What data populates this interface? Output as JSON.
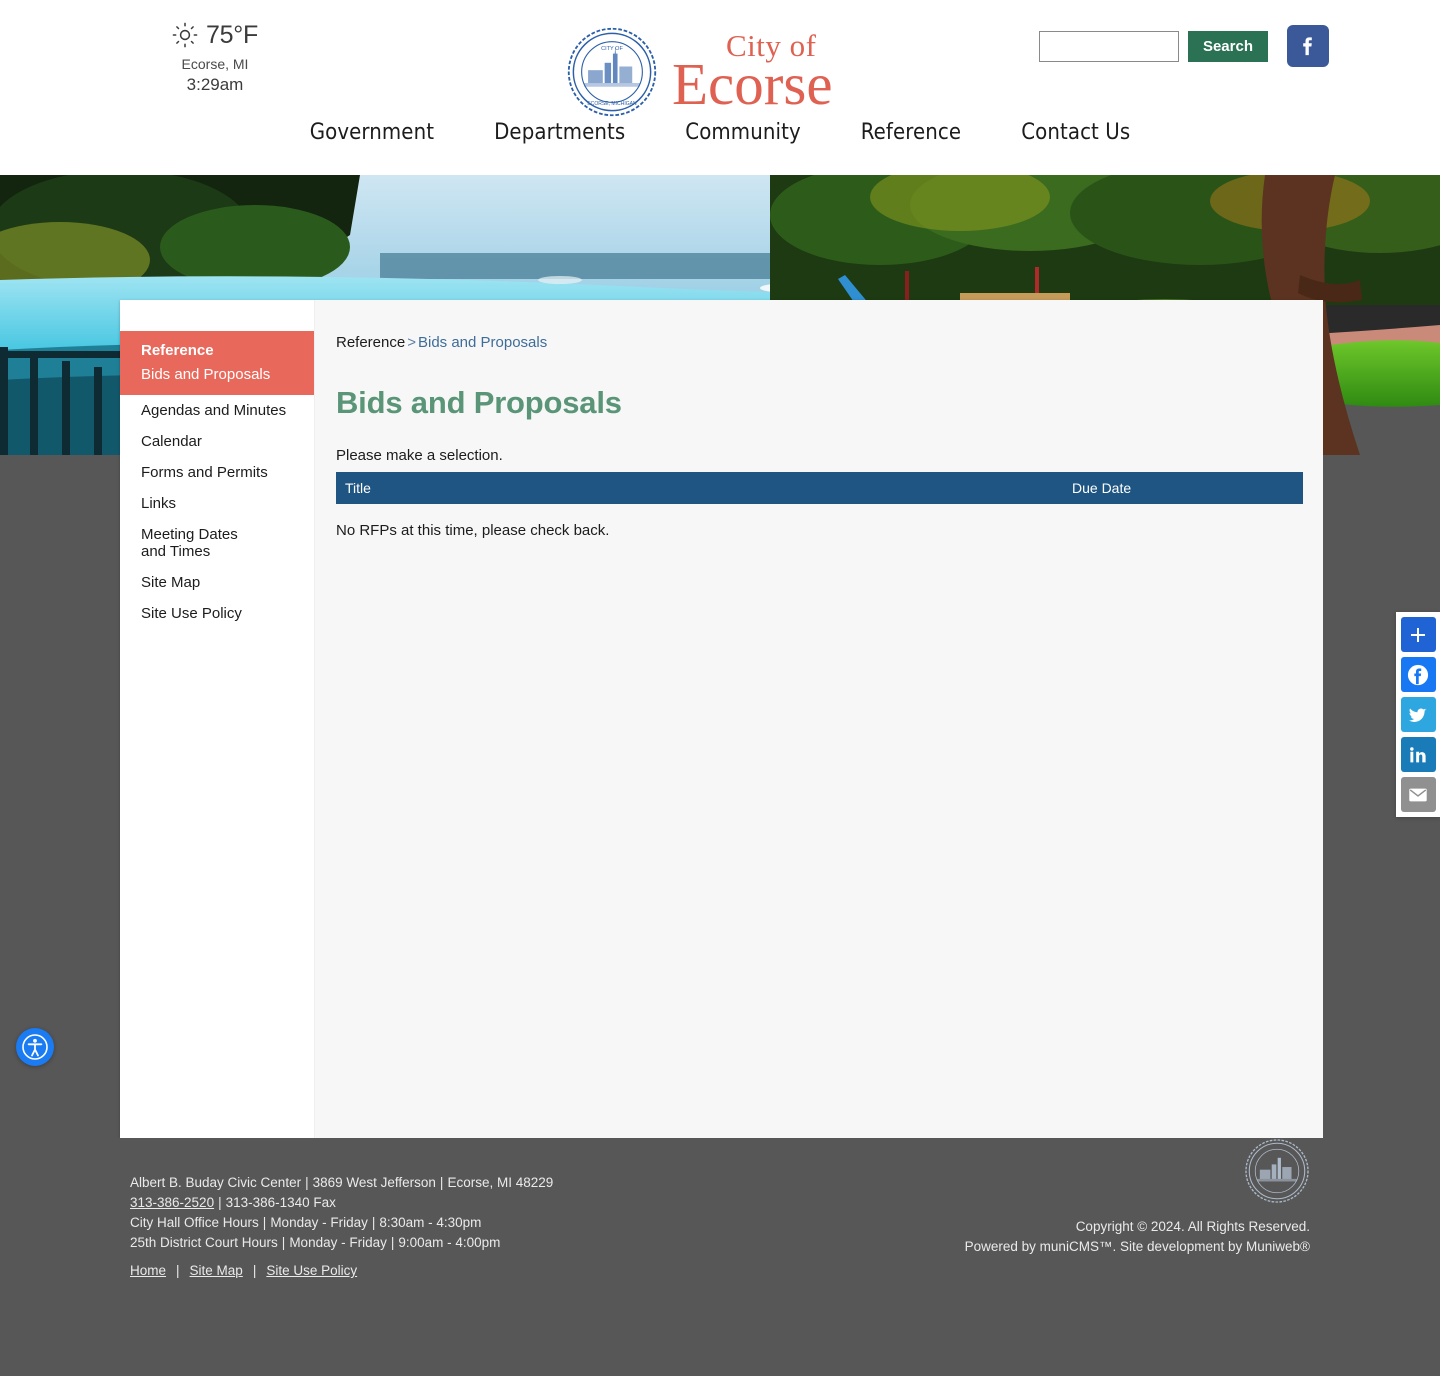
{
  "header": {
    "weather": {
      "icon": "sun-icon",
      "temperature": "75°F",
      "city": "Ecorse, MI",
      "time": "3:29am"
    },
    "logo": {
      "seal_alt": "city-seal",
      "line1": "City of",
      "line2": "Ecorse"
    },
    "search": {
      "value": "",
      "placeholder": "",
      "button_label": "Search"
    },
    "facebook": {
      "icon": "facebook-icon",
      "label": "f"
    },
    "nav": [
      {
        "label": "Government"
      },
      {
        "label": "Departments"
      },
      {
        "label": "Community"
      },
      {
        "label": "Reference"
      },
      {
        "label": "Contact Us"
      }
    ]
  },
  "sidebar": {
    "active_section": "Reference",
    "active_item": "Bids and Proposals",
    "items": [
      {
        "label": "Agendas and Minutes"
      },
      {
        "label": "Calendar"
      },
      {
        "label": "Forms and Permits"
      },
      {
        "label": "Links"
      },
      {
        "label": "Meeting Dates and Times"
      },
      {
        "label": "Site Map"
      },
      {
        "label": "Site Use Policy"
      }
    ]
  },
  "main": {
    "breadcrumb": {
      "parent": "Reference",
      "separator": ">",
      "current": "Bids and Proposals"
    },
    "title": "Bids and Proposals",
    "instruction": "Please make a selection.",
    "table": {
      "columns": [
        "Title",
        "Due Date"
      ],
      "rows": [],
      "empty_message": "No RFPs at this time, please check back."
    }
  },
  "share_rail": [
    {
      "name": "share-icon",
      "label": "Share"
    },
    {
      "name": "facebook-icon",
      "label": "Facebook"
    },
    {
      "name": "twitter-icon",
      "label": "Twitter"
    },
    {
      "name": "linkedin-icon",
      "label": "LinkedIn"
    },
    {
      "name": "email-icon",
      "label": "Email"
    }
  ],
  "accessibility": {
    "icon": "accessibility-icon",
    "label": "Accessibility Menu"
  },
  "footer": {
    "address_line": {
      "name": "Albert B. Buday Civic Center",
      "street": "3869 West Jefferson",
      "citystate": "Ecorse, MI 48229"
    },
    "phone": "313-386-2520",
    "fax": "313-386-1340 Fax",
    "city_hall_hours_label": "City Hall Office Hours",
    "city_hall_hours_days": "Monday - Friday",
    "city_hall_hours_time": "8:30am - 4:30pm",
    "court_hours_label": "25th District Court Hours",
    "court_hours_days": "Monday - Friday",
    "court_hours_time": "9:00am - 4:00pm",
    "links": [
      {
        "label": "Home"
      },
      {
        "label": "Site Map"
      },
      {
        "label": "Site Use Policy"
      }
    ],
    "copyright": "Copyright © 2024. All Rights Reserved.",
    "powered_by": "Powered by muniCMS™. Site development by Muniweb®"
  },
  "colors": {
    "accent_red": "#e8695c",
    "brand_red": "#df6152",
    "heading_green": "#5a9578",
    "table_blue": "#1f5582",
    "search_green": "#2b7153",
    "footer_gray": "#575757",
    "facebook_blue": "#3b5998"
  }
}
